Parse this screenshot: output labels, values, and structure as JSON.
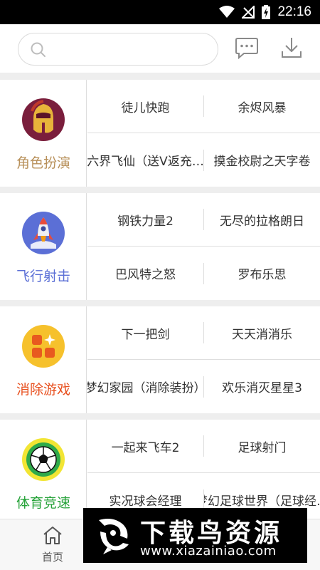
{
  "status_bar": {
    "time": "22:16"
  },
  "search": {
    "placeholder": ""
  },
  "categories": [
    {
      "label": "角色扮演",
      "label_color": "#b8905a",
      "icon": "spartan-helmet-icon",
      "games": [
        "徒儿快跑",
        "余烬风暴",
        "六界飞仙（送V返充…",
        "摸金校尉之天字卷"
      ]
    },
    {
      "label": "飞行射击",
      "label_color": "#5b6fd6",
      "icon": "rocket-icon",
      "games": [
        "钢铁力量2",
        "无尽的拉格朗日",
        "巴风特之怒",
        "罗布乐思"
      ]
    },
    {
      "label": "消除游戏",
      "label_color": "#e8501f",
      "icon": "blocks-icon",
      "games": [
        "下一把剑",
        "天天消消乐",
        "梦幻家园（消除装扮）",
        "欢乐消灭星星3"
      ]
    },
    {
      "label": "体育竞速",
      "label_color": "#27a33a",
      "icon": "soccer-ball-icon",
      "games": [
        "一起来飞车2",
        "足球射门",
        "实况球会经理",
        "梦幻足球世界（足球经…"
      ]
    }
  ],
  "bottom_nav": {
    "home_label": "首页"
  },
  "watermark": {
    "title": "下载鸟资源",
    "url": "www.xiazainiao.com"
  }
}
